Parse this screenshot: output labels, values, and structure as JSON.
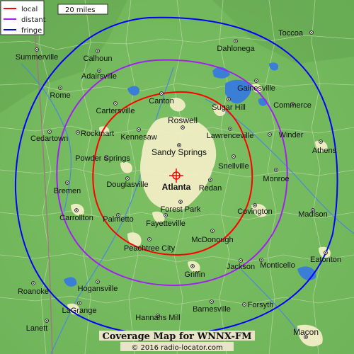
{
  "legend": [
    {
      "label": "local",
      "color": "#ff0000"
    },
    {
      "label": "distant",
      "color": "#a020f0"
    },
    {
      "label": "fringe",
      "color": "#0000ff"
    }
  ],
  "scale": {
    "label": "20 miles"
  },
  "footer": {
    "title": "Coverage Map for WNNX-FM",
    "copyright": "© 2016 radio-locator.com"
  },
  "cities": [
    "Toccoa",
    "Dahlonega",
    "Summerville",
    "Calhoun",
    "Adairsville",
    "Gainesville",
    "Rome",
    "Cartersville",
    "Canton",
    "Sugar Hill",
    "Commerce",
    "Roswell",
    "Cedartown",
    "Rockmart",
    "Kennesaw",
    "Lawrenceville",
    "Winder",
    "Athens",
    "Sandy Springs",
    "Powder Springs",
    "Snellville",
    "Douglasville",
    "Atlanta",
    "Redan",
    "Monroe",
    "Bremen",
    "Forest Park",
    "Covington",
    "Carrollton",
    "Palmetto",
    "Fayetteville",
    "Madison",
    "McDonough",
    "Peachtree City",
    "Eatonton",
    "Jackson",
    "Monticello",
    "Griffin",
    "Roanoke",
    "Hogansville",
    "LaGrange",
    "Forsyth",
    "Barnesville",
    "Hannahs Mill",
    "Lanett",
    "Macon"
  ],
  "colors": {
    "land": "#7fbf66",
    "urban": "#f0ecc4",
    "water": "#3a7fd5",
    "county_lines": "#b4cfa0",
    "state_line": "#a08080"
  }
}
